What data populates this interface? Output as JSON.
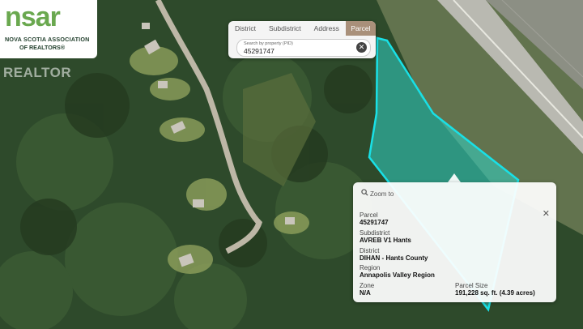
{
  "logo": {
    "mark": "nsar",
    "line1": "NOVA SCOTIA ASSOCIATION",
    "line2": "OF REALTORS®"
  },
  "watermark": "REALTOR",
  "search": {
    "tabs": [
      "District",
      "Subdistrict",
      "Address",
      "Parcel"
    ],
    "active_tab": "Parcel",
    "label": "Search by property (PID)",
    "value": "45291747"
  },
  "info": {
    "zoom_label": "Zoom to",
    "parcel_label": "Parcel",
    "parcel_value": "45291747",
    "subdistrict_label": "Subdistrict",
    "subdistrict_value": "AVREB V1 Hants",
    "district_label": "District",
    "district_value": "DIHAN - Hants County",
    "region_label": "Region",
    "region_value": "Annapolis Valley Region",
    "zone_label": "Zone",
    "zone_value": "N/A",
    "size_label": "Parcel Size",
    "size_value": "191,228 sq. ft. (4.39 acres)"
  },
  "colors": {
    "parcel_fill": "#2fd3c7",
    "parcel_stroke": "#19e0e6",
    "active_tab": "#a9907a",
    "logo_green": "#6aa84f"
  },
  "icons": [
    "magnifier-icon",
    "close-icon",
    "clear-search-icon"
  ]
}
